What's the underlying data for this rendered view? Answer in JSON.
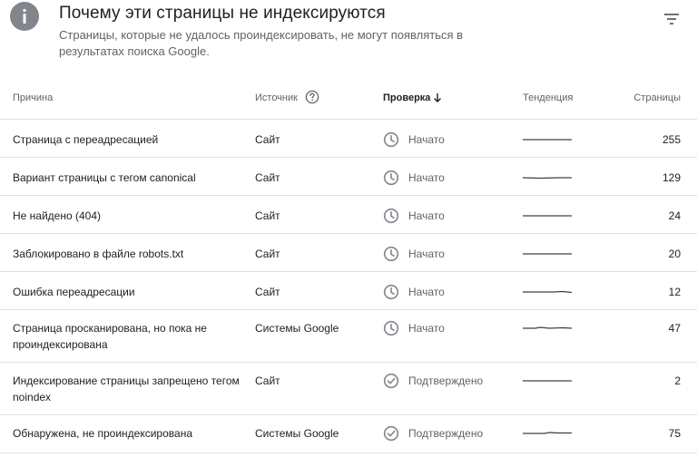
{
  "header": {
    "title": "Почему эти страницы не индексируются",
    "subtitle": "Страницы, которые не удалось проиндексировать, не могут появляться в результатах поиска Google.",
    "info_icon": "info-icon",
    "filter_icon": "filter-icon"
  },
  "table": {
    "columns": {
      "reason": "Причина",
      "source": "Источник",
      "validation": "Проверка",
      "trend": "Тенденция",
      "pages": "Страницы"
    },
    "rows": [
      {
        "reason": "Страница с переадресацией",
        "source": "Сайт",
        "status": "Начато",
        "status_icon": "clock-icon",
        "pages": "255"
      },
      {
        "reason": "Вариант страницы с тегом canonical",
        "source": "Сайт",
        "status": "Начато",
        "status_icon": "clock-icon",
        "pages": "129"
      },
      {
        "reason": "Не найдено (404)",
        "source": "Сайт",
        "status": "Начато",
        "status_icon": "clock-icon",
        "pages": "24"
      },
      {
        "reason": "Заблокировано в файле robots.txt",
        "source": "Сайт",
        "status": "Начато",
        "status_icon": "clock-icon",
        "pages": "20"
      },
      {
        "reason": "Ошибка переадресации",
        "source": "Сайт",
        "status": "Начато",
        "status_icon": "clock-icon",
        "pages": "12"
      },
      {
        "reason": "Страница просканирована, но пока не проиндексирована",
        "source": "Системы Google",
        "status": "Начато",
        "status_icon": "clock-icon",
        "pages": "47"
      },
      {
        "reason": "Индексирование страницы запрещено тегом noindex",
        "source": "Сайт",
        "status": "Подтверждено",
        "status_icon": "check-circle-icon",
        "pages": "2"
      },
      {
        "reason": "Обнаружена, не проиндексирована",
        "source": "Системы Google",
        "status": "Подтверждено",
        "status_icon": "check-circle-icon",
        "pages": "75"
      }
    ]
  },
  "colors": {
    "text": "#202124",
    "secondary": "#5f6368",
    "divider": "#e0e0e0",
    "icon_gray": "#80868b"
  }
}
